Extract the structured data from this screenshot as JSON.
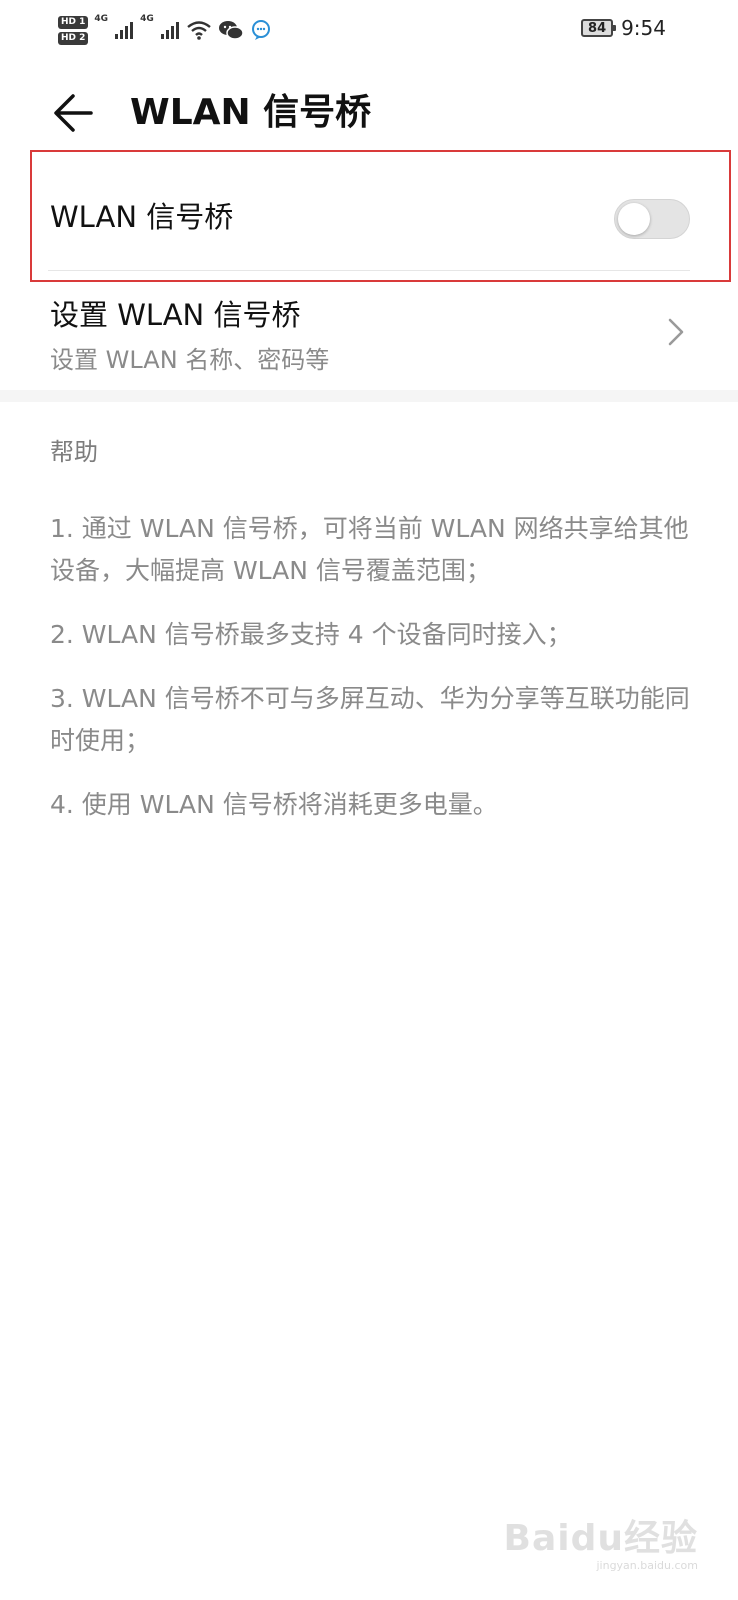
{
  "status_bar": {
    "sim1_badge": "HD 1",
    "sim2_badge": "HD 2",
    "net1": "4G",
    "net2": "4G",
    "battery": "84",
    "time": "9:54",
    "icons": [
      "signal-icon",
      "signal-icon",
      "wifi-icon",
      "wechat-icon",
      "chat-bubble-icon"
    ]
  },
  "header": {
    "title": "WLAN 信号桥",
    "back_icon": "arrow-left-icon"
  },
  "toggle_row": {
    "label": "WLAN 信号桥",
    "enabled": false
  },
  "settings_row": {
    "title": "设置 WLAN 信号桥",
    "subtitle": "设置 WLAN 名称、密码等",
    "icon": "chevron-right-icon"
  },
  "help": {
    "heading": "帮助",
    "items": [
      "1. 通过 WLAN 信号桥，可将当前 WLAN 网络共享给其他设备，大幅提高 WLAN 信号覆盖范围；",
      "2. WLAN 信号桥最多支持 4 个设备同时接入；",
      "3. WLAN 信号桥不可与多屏互动、华为分享等互联功能同时使用；",
      "4. 使用 WLAN 信号桥将消耗更多电量。"
    ]
  },
  "watermark": {
    "text": "Baidu经验",
    "url": "jingyan.baidu.com"
  },
  "colors": {
    "highlight": "#d93a3a",
    "switch_off": "#e4e4e4",
    "secondary_text": "#8a8a8a"
  }
}
